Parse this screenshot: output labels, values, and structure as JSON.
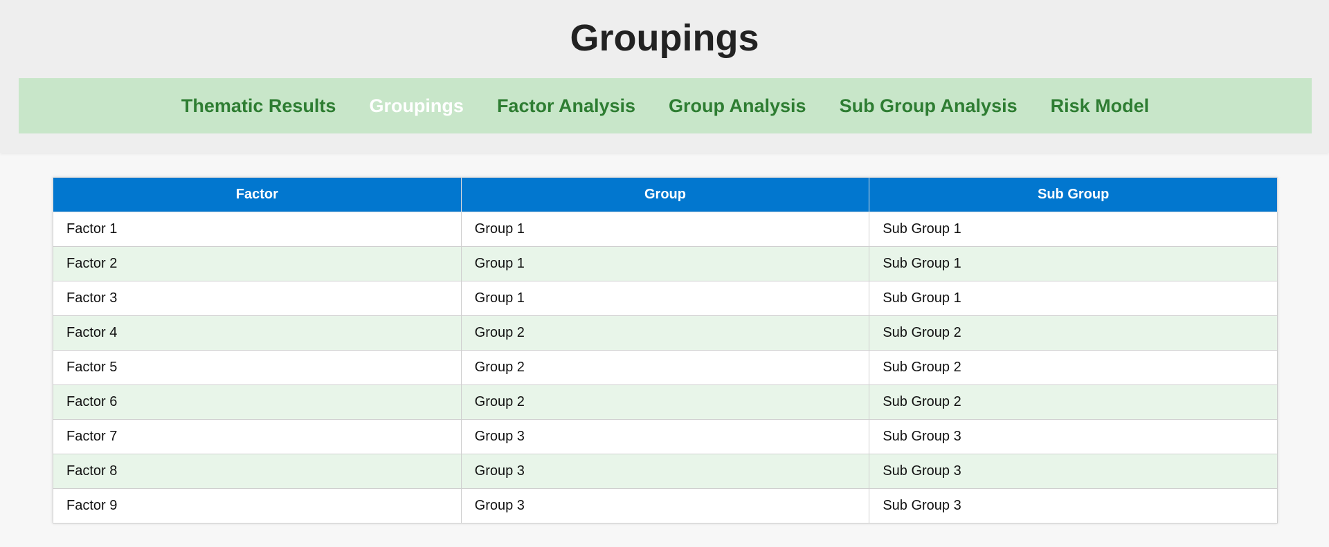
{
  "page": {
    "title": "Groupings"
  },
  "nav": {
    "items": [
      {
        "label": "Thematic Results",
        "active": false
      },
      {
        "label": "Groupings",
        "active": true
      },
      {
        "label": "Factor Analysis",
        "active": false
      },
      {
        "label": "Group Analysis",
        "active": false
      },
      {
        "label": "Sub Group Analysis",
        "active": false
      },
      {
        "label": "Risk Model",
        "active": false
      }
    ]
  },
  "table": {
    "headers": [
      "Factor",
      "Group",
      "Sub Group"
    ],
    "rows": [
      [
        "Factor 1",
        "Group 1",
        "Sub Group 1"
      ],
      [
        "Factor 2",
        "Group 1",
        "Sub Group 1"
      ],
      [
        "Factor 3",
        "Group 1",
        "Sub Group 1"
      ],
      [
        "Factor 4",
        "Group 2",
        "Sub Group 2"
      ],
      [
        "Factor 5",
        "Group 2",
        "Sub Group 2"
      ],
      [
        "Factor 6",
        "Group 2",
        "Sub Group 2"
      ],
      [
        "Factor 7",
        "Group 3",
        "Sub Group 3"
      ],
      [
        "Factor 8",
        "Group 3",
        "Sub Group 3"
      ],
      [
        "Factor 9",
        "Group 3",
        "Sub Group 3"
      ]
    ]
  },
  "colors": {
    "header_bg": "#eeeeee",
    "nav_bg": "#c8e6c9",
    "nav_text": "#2e7d32",
    "nav_active_text": "#ffffff",
    "table_header_bg": "#0277cf",
    "row_alt_bg": "#e8f5e9"
  }
}
